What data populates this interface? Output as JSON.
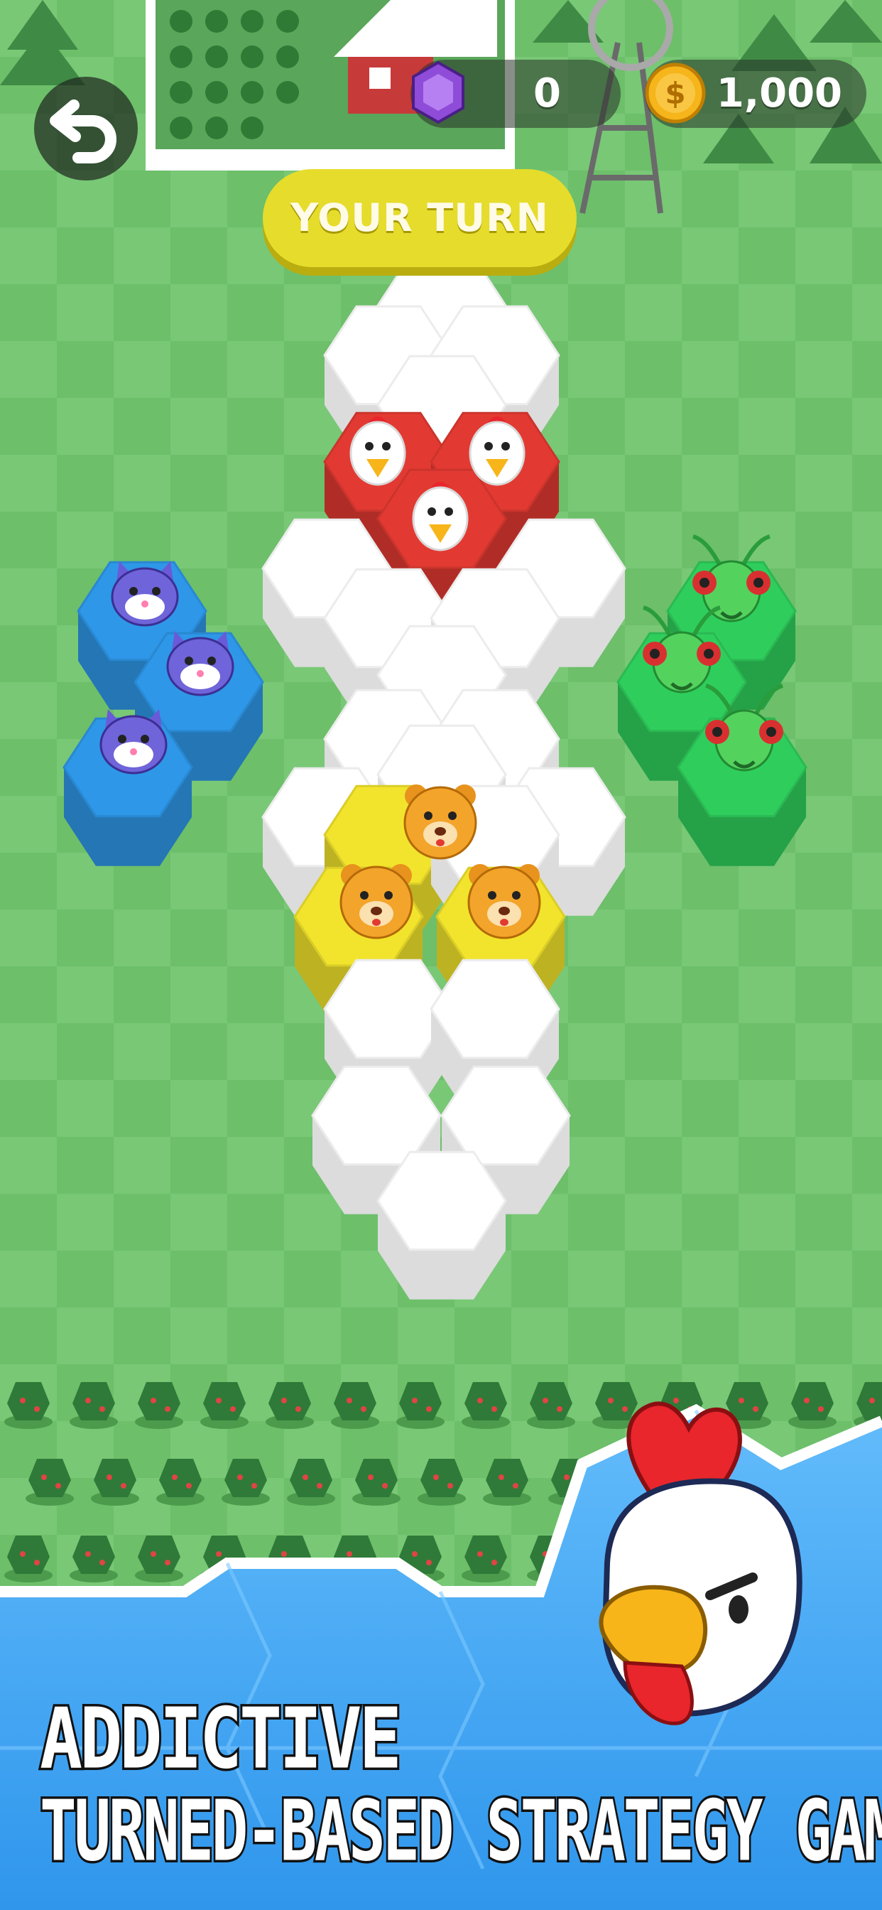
{
  "hud": {
    "gems": "0",
    "coins": "1,000"
  },
  "status_banner": "YOUR TURN",
  "promo": {
    "line1": "ADDICTIVE",
    "line2": "TURNED-BASED STRATEGY GAME"
  },
  "teams": [
    {
      "name": "chickens",
      "color": "#e23a32",
      "pieces": 3
    },
    {
      "name": "cats",
      "color": "#2e97e8",
      "pieces": 3
    },
    {
      "name": "grasshoppers",
      "color": "#2fce5c",
      "pieces": 3
    },
    {
      "name": "bears",
      "color": "#f2e42c",
      "pieces": 3
    }
  ],
  "colors": {
    "grass": "#6fc26c",
    "grass_tile": "#7cca79",
    "banner": "#e6dc2c",
    "promo_blue": "#3aa6f5"
  }
}
